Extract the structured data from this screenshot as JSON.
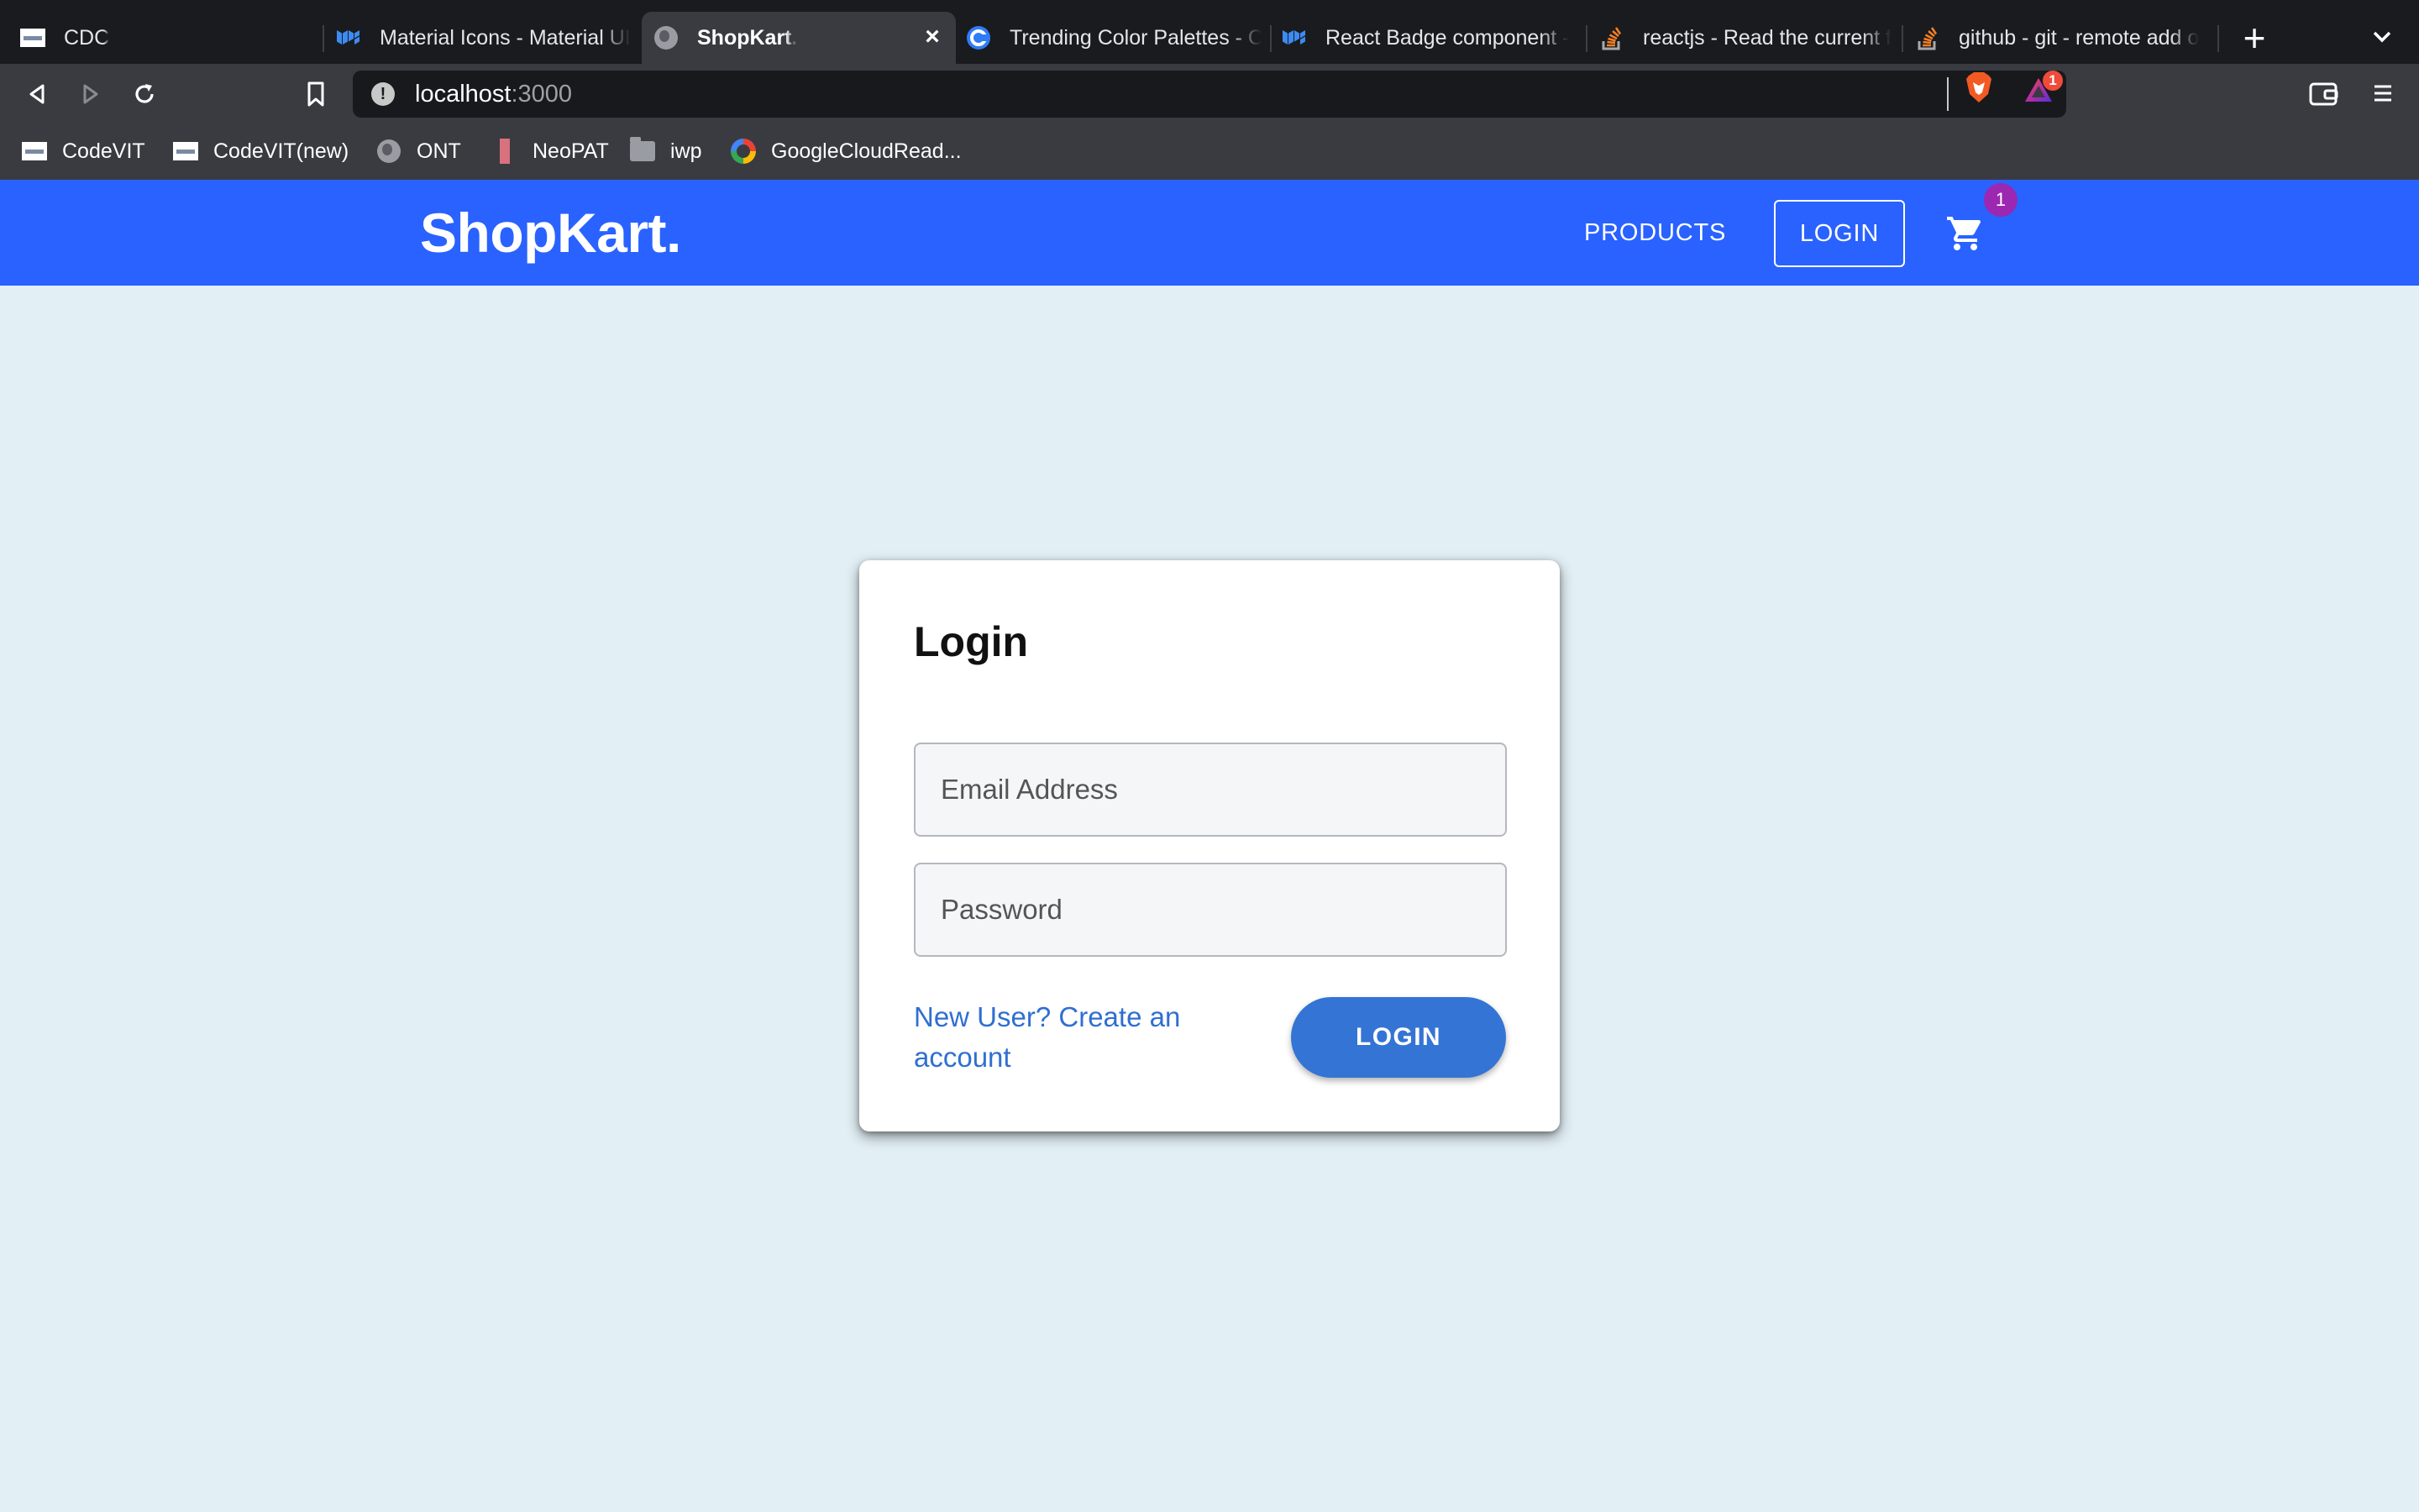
{
  "browser": {
    "tabs": [
      {
        "title": "CDC",
        "icon": "site-favicon",
        "active": false
      },
      {
        "title": "Material Icons - Material UI",
        "icon": "mui-logo-icon",
        "active": false
      },
      {
        "title": "ShopKart.",
        "icon": "globe-icon",
        "active": true
      },
      {
        "title": "Trending Color Palettes - C",
        "icon": "coolors-icon",
        "active": false
      },
      {
        "title": "React Badge component -",
        "icon": "mui-logo-icon",
        "active": false
      },
      {
        "title": "reactjs - Read the current f",
        "icon": "stackoverflow-icon",
        "active": false
      },
      {
        "title": "github - git - remote add o",
        "icon": "stackoverflow-icon",
        "active": false
      }
    ],
    "address": {
      "host": "localhost",
      "port": ":3000"
    },
    "rewards_count": "1",
    "bookmarks": [
      {
        "label": "CodeVIT",
        "icon": "site-favicon"
      },
      {
        "label": "CodeVIT(new)",
        "icon": "site-favicon"
      },
      {
        "label": "ONT",
        "icon": "globe-icon"
      },
      {
        "label": "NeoPAT",
        "icon": "neopat-icon"
      },
      {
        "label": "iwp",
        "icon": "folder-icon"
      },
      {
        "label": "GoogleCloudRead...",
        "icon": "google-icon"
      }
    ]
  },
  "header": {
    "brand": "ShopKart.",
    "nav_products": "PRODUCTS",
    "nav_login": "LOGIN",
    "cart_count": "1",
    "accent_color": "#2962ff",
    "badge_color": "#9c27b0"
  },
  "login_card": {
    "title": "Login",
    "email_placeholder": "Email Address",
    "password_placeholder": "Password",
    "signup_text": "New User? Create an account",
    "submit_label": "LOGIN",
    "button_color": "#3474d4",
    "link_color": "#2f6fd1"
  },
  "page": {
    "background": "#e2eff5"
  }
}
